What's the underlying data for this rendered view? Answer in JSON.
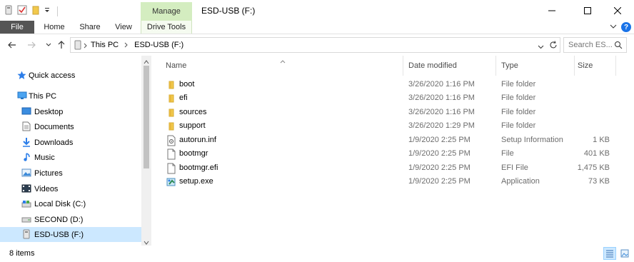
{
  "window": {
    "title": "ESD-USB (F:)",
    "contextual_tab": "Manage"
  },
  "ribbon": {
    "tabs": [
      "File",
      "Home",
      "Share",
      "View",
      "Drive Tools"
    ]
  },
  "address": {
    "crumbs": [
      "This PC",
      "ESD-USB (F:)"
    ]
  },
  "search": {
    "placeholder": "Search ES..."
  },
  "nav": {
    "items": [
      {
        "label": "Quick access",
        "icon": "star-icon"
      },
      {
        "label": "This PC",
        "icon": "pc-icon"
      },
      {
        "label": "Desktop",
        "icon": "desktop-icon"
      },
      {
        "label": "Documents",
        "icon": "documents-icon"
      },
      {
        "label": "Downloads",
        "icon": "downloads-icon"
      },
      {
        "label": "Music",
        "icon": "music-icon"
      },
      {
        "label": "Pictures",
        "icon": "pictures-icon"
      },
      {
        "label": "Videos",
        "icon": "videos-icon"
      },
      {
        "label": "Local Disk (C:)",
        "icon": "drive-icon"
      },
      {
        "label": "SECOND (D:)",
        "icon": "drive-icon"
      },
      {
        "label": "ESD-USB (F:)",
        "icon": "usb-drive-icon",
        "selected": true
      }
    ]
  },
  "columns": [
    "Name",
    "Date modified",
    "Type",
    "Size"
  ],
  "files": [
    {
      "name": "boot",
      "date": "3/26/2020 1:16 PM",
      "type": "File folder",
      "size": "",
      "icon": "folder-icon"
    },
    {
      "name": "efi",
      "date": "3/26/2020 1:16 PM",
      "type": "File folder",
      "size": "",
      "icon": "folder-icon"
    },
    {
      "name": "sources",
      "date": "3/26/2020 1:16 PM",
      "type": "File folder",
      "size": "",
      "icon": "folder-icon"
    },
    {
      "name": "support",
      "date": "3/26/2020 1:29 PM",
      "type": "File folder",
      "size": "",
      "icon": "folder-icon"
    },
    {
      "name": "autorun.inf",
      "date": "1/9/2020 2:25 PM",
      "type": "Setup Information",
      "size": "1 KB",
      "icon": "setup-info-icon"
    },
    {
      "name": "bootmgr",
      "date": "1/9/2020 2:25 PM",
      "type": "File",
      "size": "401 KB",
      "icon": "file-icon"
    },
    {
      "name": "bootmgr.efi",
      "date": "1/9/2020 2:25 PM",
      "type": "EFI File",
      "size": "1,475 KB",
      "icon": "file-icon"
    },
    {
      "name": "setup.exe",
      "date": "1/9/2020 2:25 PM",
      "type": "Application",
      "size": "73 KB",
      "icon": "setup-exe-icon"
    }
  ],
  "status": {
    "item_count": "8 items"
  },
  "colors": {
    "manage_tab": "#d4edc0",
    "file_tab": "#555555",
    "selection": "#cce8ff",
    "folder": "#e8b93e",
    "accent": "#1a73e8"
  }
}
